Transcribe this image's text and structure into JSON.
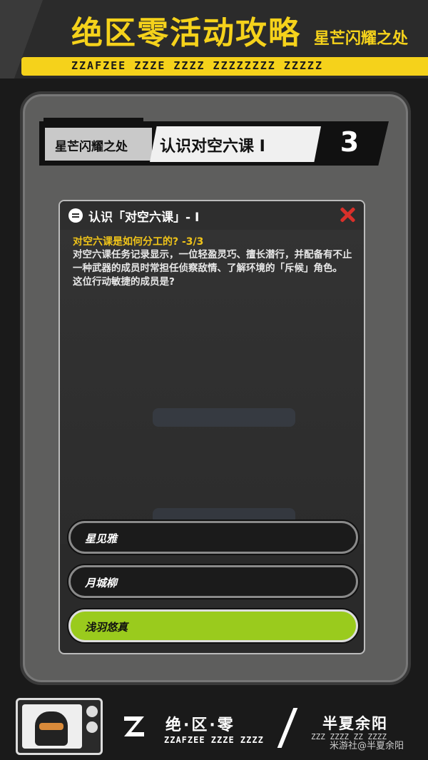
{
  "header": {
    "title": "绝区零活动攻略",
    "subtitle": "星芒闪耀之处",
    "decorative_glyph": "ZZAFZEE ZZZE ZZZZ ZZZZZZZZ ZZZZZ"
  },
  "quest_bar": {
    "location": "星芒闪耀之处",
    "quest_name": "认识对空六课 I",
    "number": "3"
  },
  "dialog": {
    "title": "认识「对空六课」- I",
    "question_heading": "对空六课是如何分工的? -3/3",
    "question_body": "对空六课任务记录显示，一位轻盈灵巧、擅长潜行，并配备有不止一种武器的成员时常担任侦察敌情、了解环境的「斥候」角色。\n这位行动敏捷的成员是?",
    "options": [
      {
        "label": "星见雅",
        "selected": false
      },
      {
        "label": "月城柳",
        "selected": false
      },
      {
        "label": "浅羽悠真",
        "selected": true
      }
    ]
  },
  "footer": {
    "game_name": "绝·区·零",
    "game_glyph": "ZZAFZEE ZZZE ZZZZ",
    "author": "半夏余阳",
    "author_glyph": "ZZZ ZZZZ ZZ ZZZZ",
    "watermark": "米游社@半夏余阳"
  },
  "colors": {
    "accent_yellow": "#f5d21b",
    "selected_green": "#9acb1d",
    "close_red": "#d9302a"
  }
}
